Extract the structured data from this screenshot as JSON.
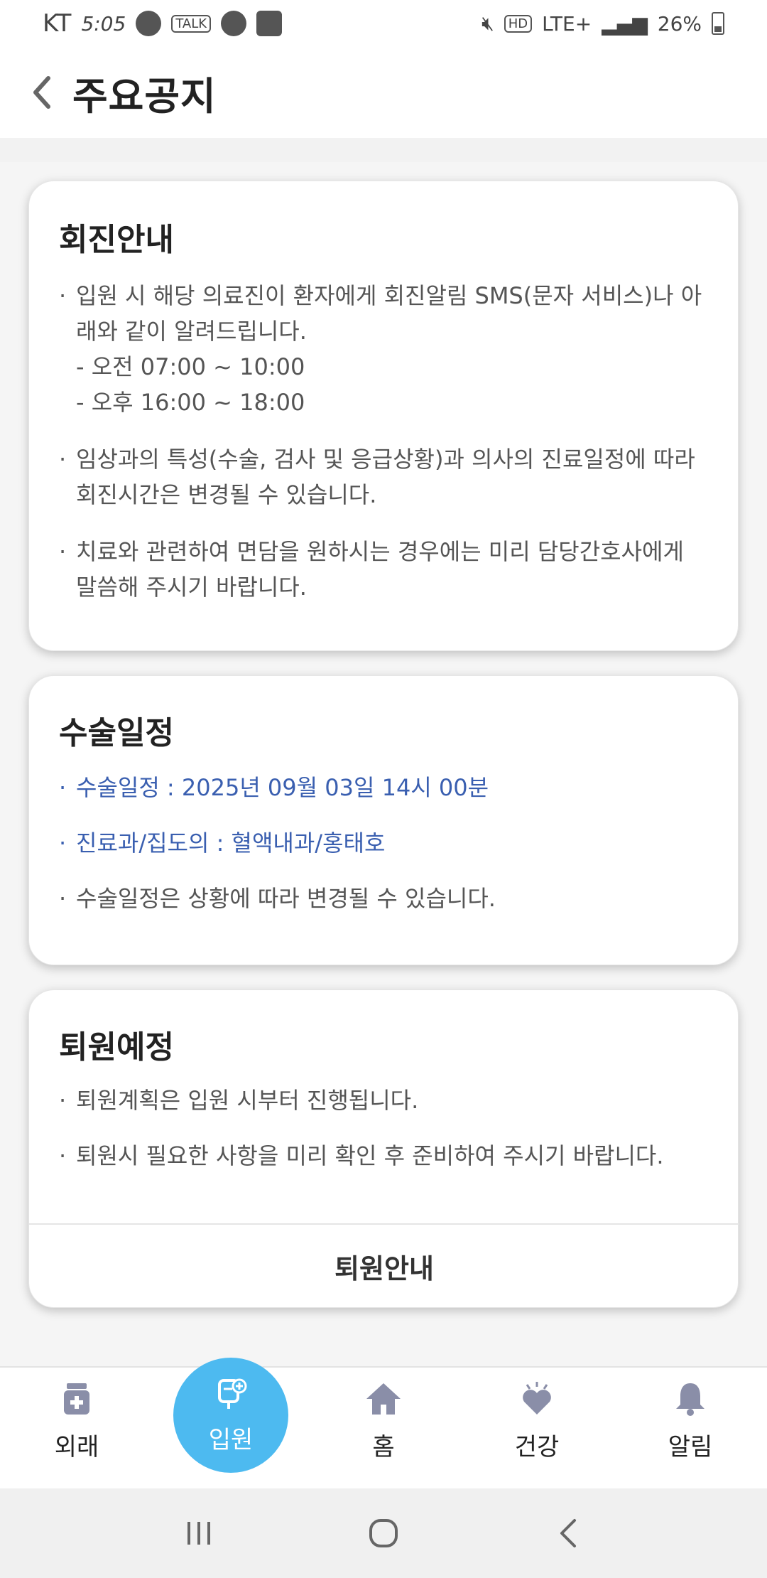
{
  "status_bar": {
    "carrier": "KT",
    "time": "5:05",
    "talk_badge": "TALK",
    "hd_badge": "HD",
    "network": "LTE+",
    "battery": "26%"
  },
  "header": {
    "title": "주요공지"
  },
  "cards": {
    "reply": {
      "title": "회진안내",
      "bullet1": "입원 시 해당 의료진이 환자에게 회진알림 SMS(문자 서비스)나 아\n래와 같이 알려드립니다.",
      "sub1": "- 오전 07:00 ~ 10:00",
      "sub2": "- 오후 16:00 ~ 18:00",
      "bullet2": "임상과의 특성(수술, 검사 및 응급상황)과 의사의 진료일정에 따라\n회진시간은 변경될 수 있습니다.",
      "bullet3": "치료와 관련하여 면담을 원하시는 경우에는 미리 담당간호사에게\n말씀해 주시기 바랍니다."
    },
    "surgery": {
      "title": "수술일정",
      "bullet1": "수술일정 : 2025년 09월 03일 14시 00분",
      "bullet2": "진료과/집도의 : 혈액내과/홍태호",
      "bullet3": "수술일정은 상황에 따라 변경될 수 있습니다."
    },
    "discharge": {
      "title": "퇴원예정",
      "bullet1": "퇴원계획은 입원 시부터 진행됩니다.",
      "bullet2": "퇴원시 필요한 사항을 미리 확인 후 준비하여 주시기 바랍니다.",
      "button": "퇴원안내"
    }
  },
  "bottom_nav": {
    "items": [
      {
        "label": "외래",
        "icon": "medicine-bottle-icon"
      },
      {
        "label": "입원",
        "icon": "iv-bag-icon",
        "active": true
      },
      {
        "label": "홈",
        "icon": "home-icon"
      },
      {
        "label": "건강",
        "icon": "heart-icon"
      },
      {
        "label": "알림",
        "icon": "bell-icon"
      }
    ]
  },
  "colors": {
    "accent": "#4dbaf0",
    "link_blue": "#3a5fb0",
    "nav_icon": "#8a8ea8"
  }
}
